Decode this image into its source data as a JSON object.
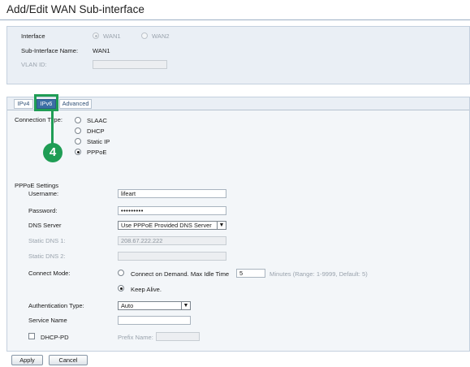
{
  "page": {
    "title": "Add/Edit WAN Sub-interface"
  },
  "interface": {
    "label": "Interface",
    "options": [
      {
        "label": "WAN1",
        "selected": true
      },
      {
        "label": "WAN2",
        "selected": false
      }
    ],
    "sub_interface_label": "Sub-Interface Name:",
    "sub_interface_value": "WAN1",
    "vlan_label": "VLAN ID:",
    "vlan_value": ""
  },
  "tabs": [
    {
      "label": "IPv4",
      "active": false
    },
    {
      "label": "IPv6",
      "active": true
    },
    {
      "label": "Advanced",
      "active": false
    }
  ],
  "connection": {
    "label": "Connection Type:",
    "options": [
      {
        "label": "SLAAC",
        "selected": false
      },
      {
        "label": "DHCP",
        "selected": false
      },
      {
        "label": "Static IP",
        "selected": false
      },
      {
        "label": "PPPoE",
        "selected": true
      }
    ]
  },
  "pppoe": {
    "section_label": "PPPoE Settings",
    "username_label": "Username:",
    "username_value": "lifeart",
    "password_label": "Password:",
    "password_value": "•••••••••",
    "dns_label": "DNS Server",
    "dns_value": "Use PPPoE Provided DNS Server",
    "static_dns1_label": "Static DNS 1:",
    "static_dns1_value": "208.67.222.222",
    "static_dns2_label": "Static DNS 2:",
    "static_dns2_value": "",
    "connect_mode_label": "Connect Mode:",
    "connect_on_demand_label": "Connect on Demand. Max Idle Time",
    "connect_on_demand_selected": false,
    "max_idle_value": "5",
    "max_idle_hint": "Minutes (Range: 1-9999, Default: 5)",
    "keep_alive_label": "Keep Alive.",
    "keep_alive_selected": true,
    "auth_label": "Authentication Type:",
    "auth_value": "Auto",
    "service_label": "Service Name",
    "service_value": "",
    "dhcp_pd_label": "DHCP-PD",
    "dhcp_pd_checked": false,
    "prefix_label": "Prefix Name:",
    "prefix_value": ""
  },
  "buttons": {
    "apply": "Apply",
    "cancel": "Cancel"
  },
  "annotation": {
    "step": "4",
    "color": "#1f9d55"
  },
  "colors": {
    "accent": "#3b6ea5",
    "panel": "#eaeff5",
    "border": "#c4d0de"
  }
}
